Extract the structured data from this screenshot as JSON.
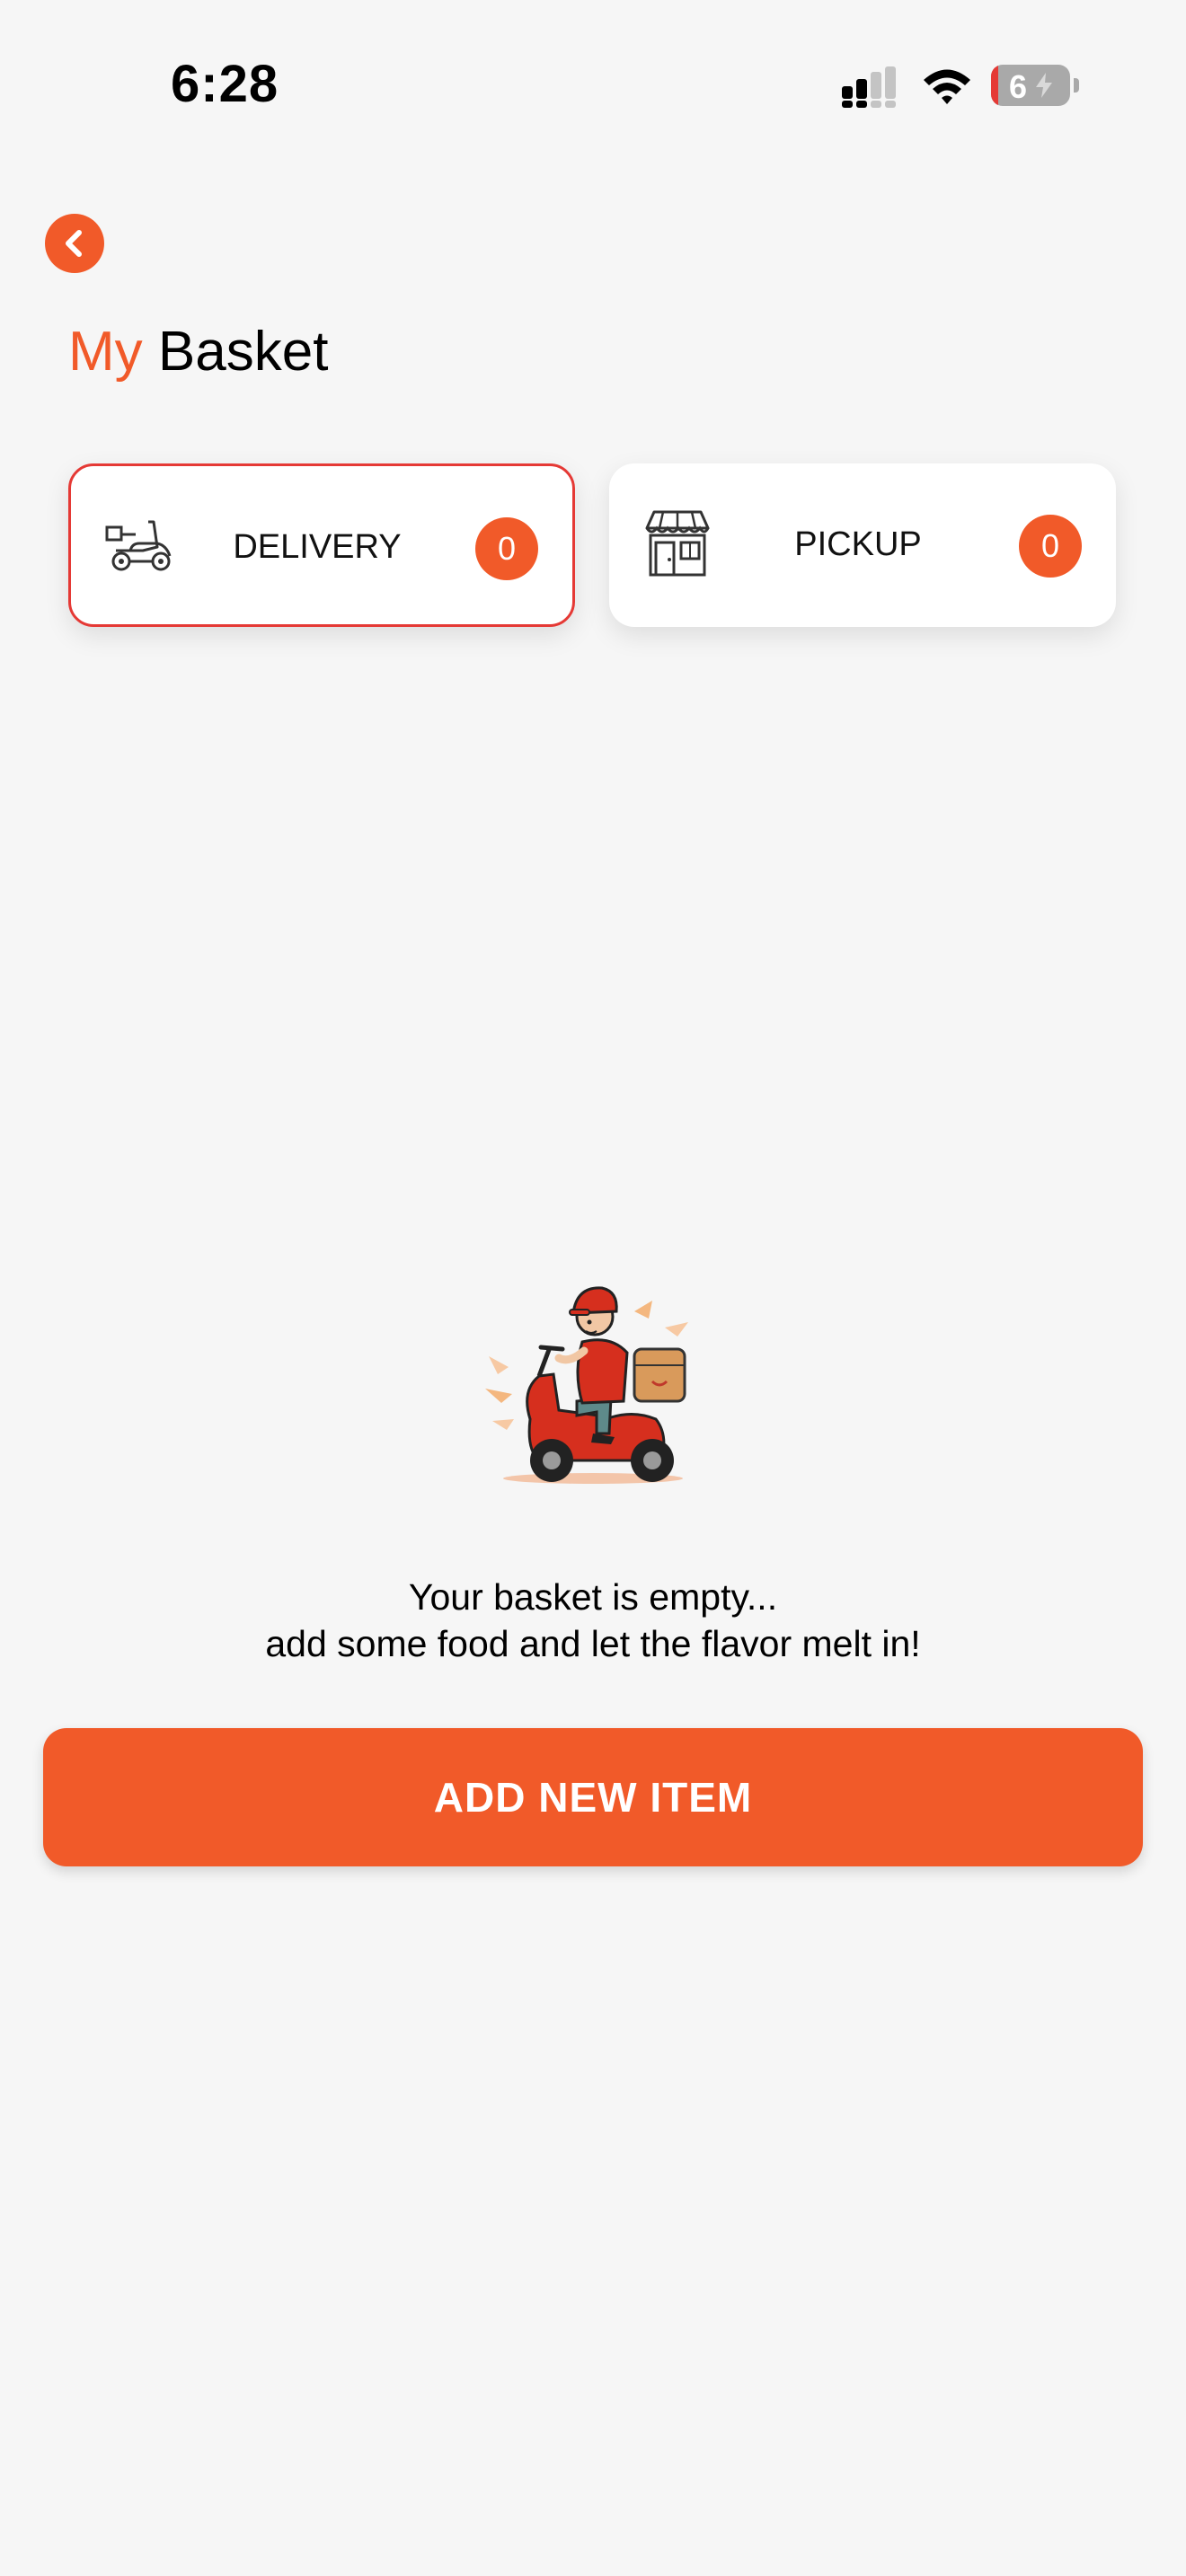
{
  "status_bar": {
    "time": "6:28",
    "battery_level": "6",
    "icons": [
      "signal-icon",
      "wifi-icon",
      "battery-icon"
    ]
  },
  "header": {
    "back_icon": "chevron-left-icon",
    "title_accent": "My",
    "title_main": "Basket"
  },
  "tabs": [
    {
      "label": "DELIVERY",
      "count": "0",
      "icon": "scooter-icon",
      "selected": true
    },
    {
      "label": "PICKUP",
      "count": "0",
      "icon": "storefront-icon",
      "selected": false
    }
  ],
  "empty_state": {
    "illustration": "delivery-rider-illustration",
    "line1": "Your basket is empty...",
    "line2": "add some food and let the flavor melt in!"
  },
  "actions": {
    "add_new_item": "ADD NEW ITEM"
  },
  "colors": {
    "accent": "#f15a29",
    "selected_border": "#e53935",
    "background": "#f6f6f6"
  }
}
